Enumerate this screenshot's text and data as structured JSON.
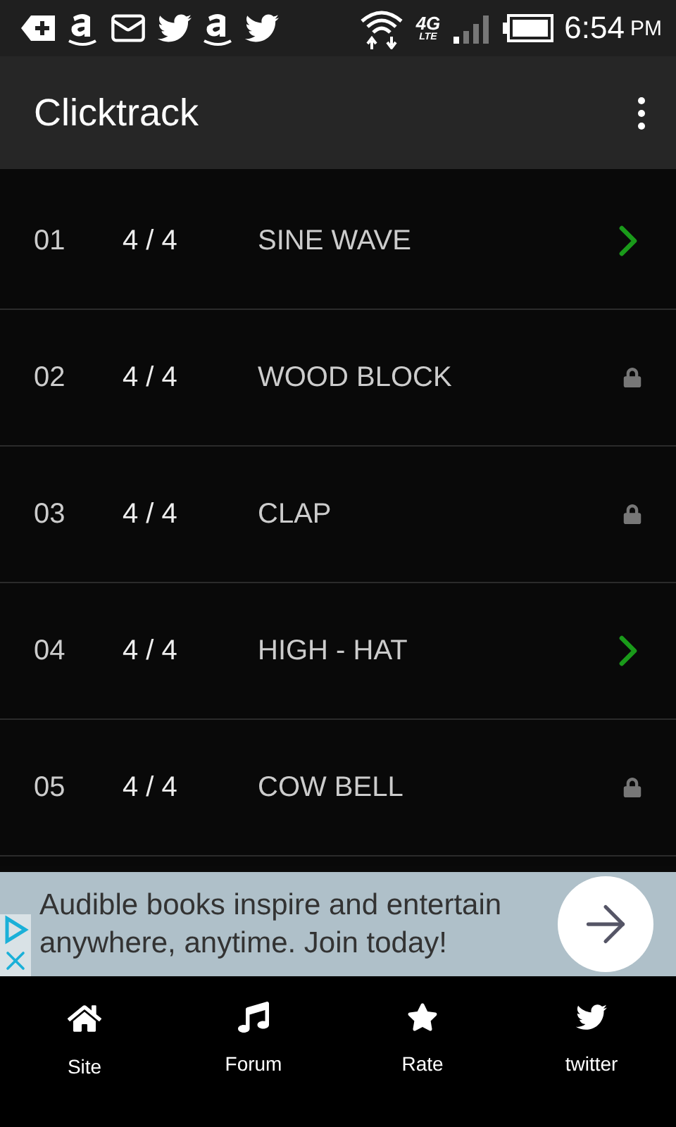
{
  "status_bar": {
    "network": "4G",
    "network_sub": "LTE",
    "time": "6:54",
    "meridiem": "PM"
  },
  "app_bar": {
    "title": "Clicktrack"
  },
  "tracks": [
    {
      "number": "01",
      "meter": "4 / 4",
      "name": "SINE WAVE",
      "locked": false
    },
    {
      "number": "02",
      "meter": "4 / 4",
      "name": "WOOD BLOCK",
      "locked": true
    },
    {
      "number": "03",
      "meter": "4 / 4",
      "name": "CLAP",
      "locked": true
    },
    {
      "number": "04",
      "meter": "4 / 4",
      "name": "HIGH - HAT",
      "locked": false
    },
    {
      "number": "05",
      "meter": "4 / 4",
      "name": "COW BELL",
      "locked": true
    }
  ],
  "ad": {
    "text": "Audible books inspire and entertain anywhere, anytime. Join today!"
  },
  "bottom_nav": [
    {
      "label": "Site",
      "kind": "home"
    },
    {
      "label": "Forum",
      "kind": "music"
    },
    {
      "label": "Rate",
      "kind": "star"
    },
    {
      "label": "twitter",
      "kind": "bird"
    }
  ]
}
